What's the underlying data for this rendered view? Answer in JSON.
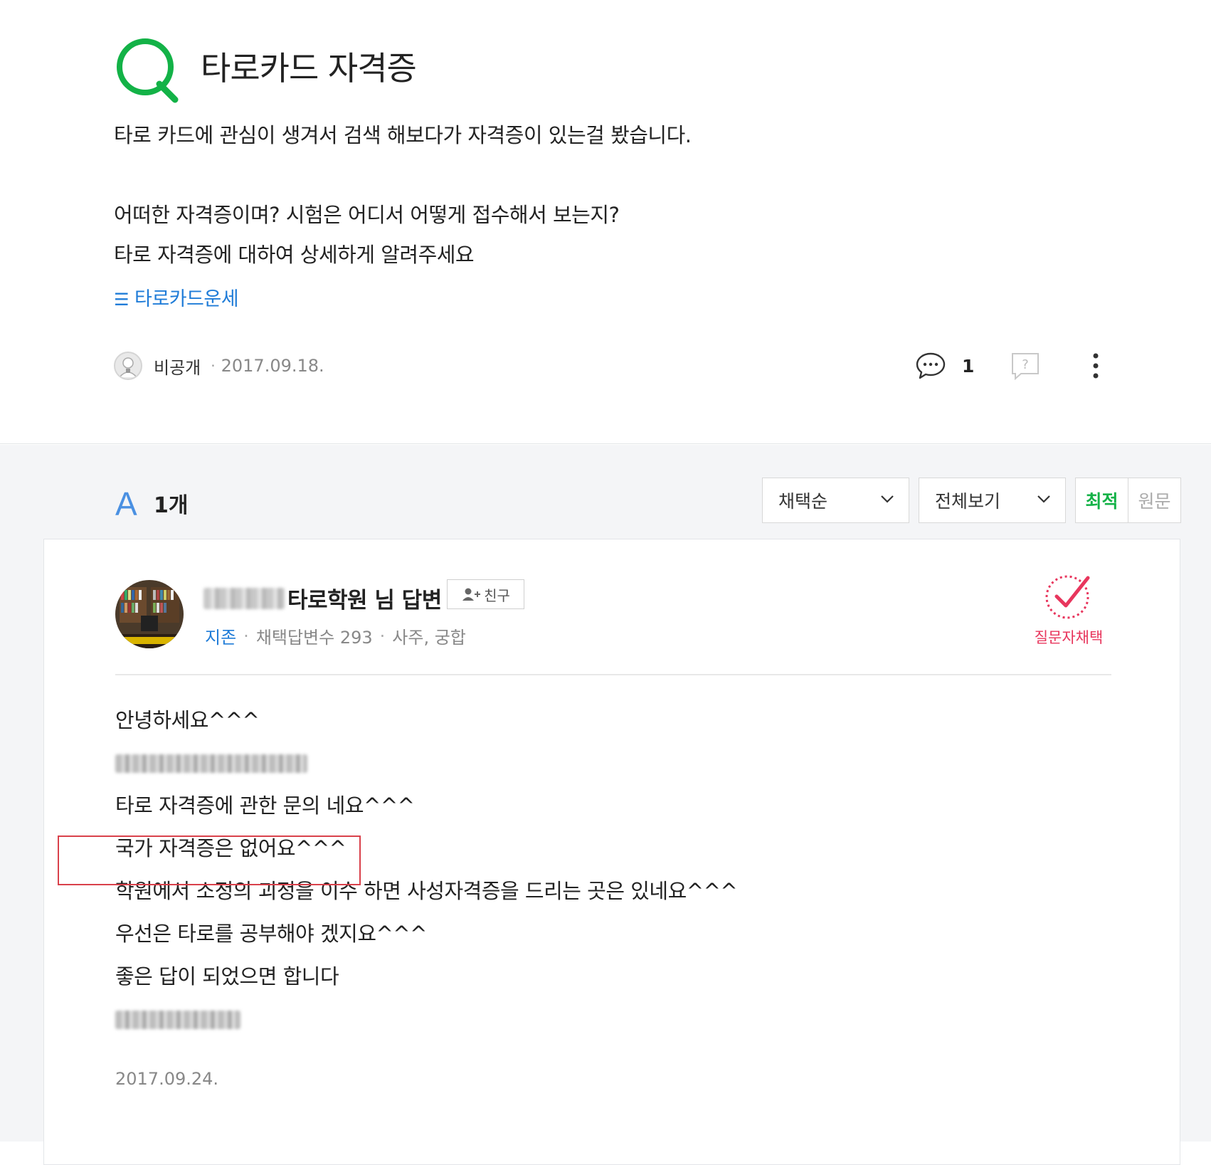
{
  "question": {
    "title": "타로카드 자격증",
    "body": [
      "타로 카드에 관심이 생겨서 검색 해보다가 자격증이 있는걸 봤습니다.",
      "",
      "어떠한 자격증이며? 시험은 어디서 어떻게 접수해서 보는지?",
      "타로 자격증에 대하여 상세하게 알려주세요"
    ],
    "tag": "타로카드운세",
    "author": "비공개",
    "date": "2017.09.18.",
    "comment_count": "1"
  },
  "answers_header": {
    "mark": "A",
    "count_label": "1개",
    "sort_label": "채택순",
    "filter_label": "전체보기",
    "toggle_on": "최적",
    "toggle_off": "원문"
  },
  "answer": {
    "name_suffix": "타로학원 님 답변",
    "friend_label": "친구",
    "rank": "지존",
    "adopt_count": "채택답변수 293",
    "fields": "사주, 궁합",
    "adopt_label": "질문자채택",
    "lines": [
      "안녕하세요^^^",
      "",
      "타로 자격증에 관한 문의 네요^^^",
      "국가 자격증은 없어요^^^",
      "학원에서 소정의 괴정을 이수 하면 사성자격증을 드리는 곳은 있네요^^^",
      "우선은 타로를 공부해야 겠지요^^^",
      "좋은 답이 되었으면 합니다",
      ""
    ],
    "date": "2017.09.24."
  },
  "colors": {
    "accent_green": "#13b247",
    "link_blue": "#1f7cd8",
    "adopt_red": "#e8365d",
    "highlight_red": "#d9414b"
  }
}
